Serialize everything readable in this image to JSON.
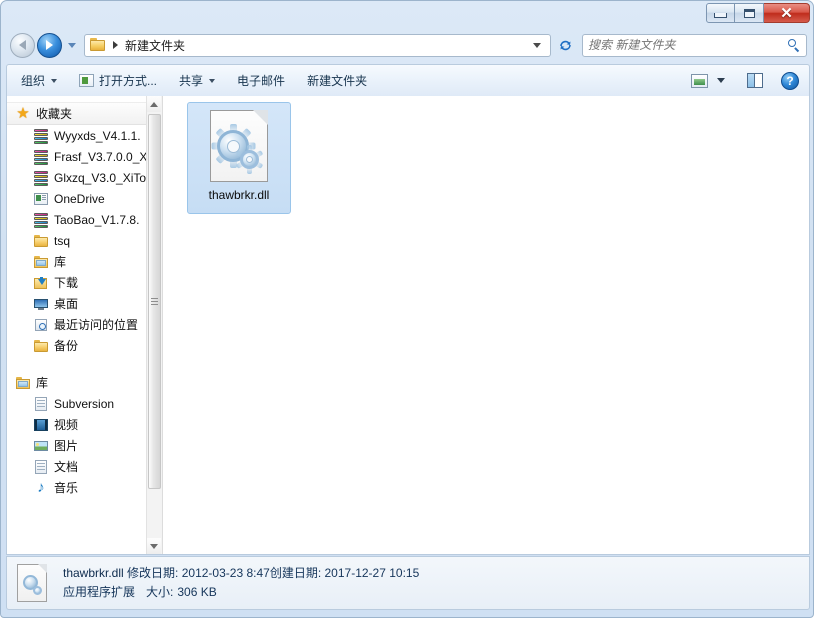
{
  "window": {
    "minimize_label": "—",
    "maximize_label": "□",
    "close_label": "✕"
  },
  "address": {
    "breadcrumb_folder": "新建文件夹",
    "dropdown_icon": "chevron-down-icon",
    "refresh_icon": "refresh-icon",
    "back_icon": "back-arrow-icon",
    "forward_icon": "forward-arrow-icon"
  },
  "search": {
    "placeholder": "搜索 新建文件夹",
    "value": "",
    "icon": "search-icon"
  },
  "command_bar": {
    "items": [
      {
        "label": "组织",
        "has_caret": true,
        "has_icon": false
      },
      {
        "label": "打开方式...",
        "has_caret": false,
        "has_icon": true
      },
      {
        "label": "共享",
        "has_caret": true,
        "has_icon": false
      },
      {
        "label": "电子邮件",
        "has_caret": false,
        "has_icon": false
      },
      {
        "label": "新建文件夹",
        "has_caret": false,
        "has_icon": false
      }
    ],
    "view_icon": "view-mode-icon",
    "view_caret_icon": "chevron-down-icon",
    "preview_pane_icon": "preview-pane-icon",
    "help_icon": "help-icon",
    "help_label": "?"
  },
  "sidebar": {
    "favorites": {
      "label": "收藏夹",
      "icon": "star-icon"
    },
    "favorite_items": [
      {
        "label": "Wyyxds_V4.1.1.",
        "icon": "archive-icon"
      },
      {
        "label": "Frasf_V3.7.0.0_X",
        "icon": "archive-icon"
      },
      {
        "label": "Glxzq_V3.0_XiTo",
        "icon": "archive-icon"
      },
      {
        "label": "OneDrive",
        "icon": "onedrive-icon"
      },
      {
        "label": "TaoBao_V1.7.8.",
        "icon": "archive-icon"
      },
      {
        "label": "tsq",
        "icon": "folder-icon"
      },
      {
        "label": "库",
        "icon": "library-icon"
      },
      {
        "label": "下载",
        "icon": "download-icon"
      },
      {
        "label": "桌面",
        "icon": "desktop-icon"
      },
      {
        "label": "最近访问的位置",
        "icon": "recent-places-icon"
      },
      {
        "label": "备份",
        "icon": "folder-icon"
      }
    ],
    "libraries": {
      "label": "库",
      "icon": "library-icon"
    },
    "library_items": [
      {
        "label": "Subversion",
        "icon": "document-icon"
      },
      {
        "label": "视频",
        "icon": "video-icon"
      },
      {
        "label": "图片",
        "icon": "picture-icon"
      },
      {
        "label": "文档",
        "icon": "document-icon"
      },
      {
        "label": "音乐",
        "icon": "music-icon"
      }
    ],
    "scrollbar": {
      "up_icon": "scroll-up-icon",
      "down_icon": "scroll-down-icon"
    }
  },
  "content": {
    "file": {
      "name": "thawbrkr.dll",
      "icon": "dll-file-icon",
      "selected": true
    }
  },
  "status": {
    "file_name": "thawbrkr.dll",
    "modified_label": "修改日期:",
    "modified_value": "2012-03-23 8:47",
    "created_label": "创建日期:",
    "created_value": "2017-12-27 10:15",
    "file_type": "应用程序扩展",
    "size_label": "大小:",
    "size_value": "306 KB",
    "icon": "dll-file-icon"
  }
}
